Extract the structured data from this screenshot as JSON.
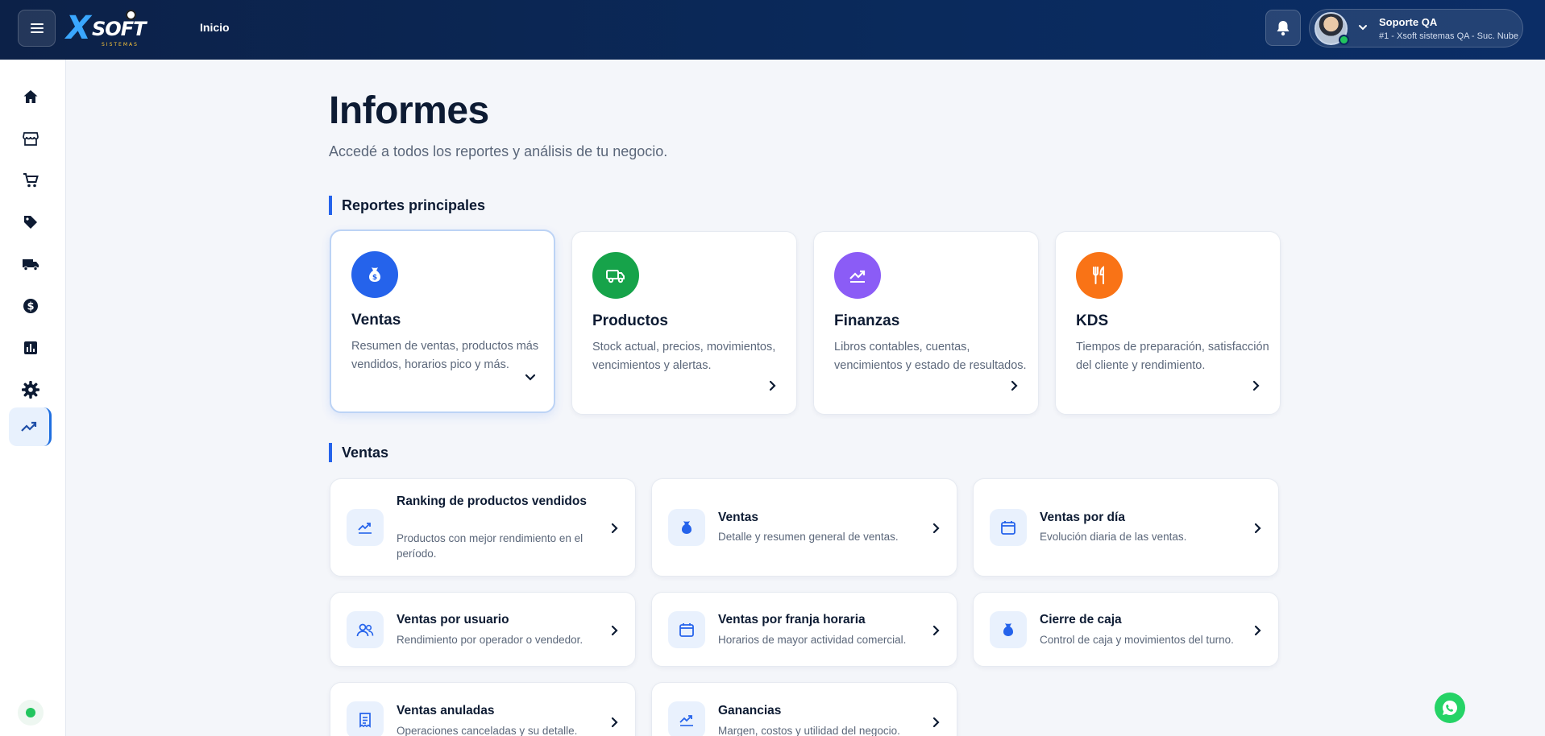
{
  "header": {
    "breadcrumb": "Inicio",
    "logo_text": "SOFT",
    "logo_x": "X",
    "logo_sub": "SISTEMAS",
    "user_name": "Soporte QA",
    "user_branch": "#1 - Xsoft sistemas QA - Suc. Nube"
  },
  "sidebar": {
    "items": [
      {
        "icon": "home-icon"
      },
      {
        "icon": "store-icon"
      },
      {
        "icon": "cart-icon"
      },
      {
        "icon": "tag-icon"
      },
      {
        "icon": "truck-icon"
      },
      {
        "icon": "dollar-icon"
      },
      {
        "icon": "bar-chart-icon"
      },
      {
        "icon": "gear-icon"
      },
      {
        "icon": "trending-up-icon",
        "active": true
      }
    ]
  },
  "main": {
    "title": "Informes",
    "subtitle": "Accedé a todos los reportes y análisis de tu negocio.",
    "section_main": "Reportes principales",
    "section_sales": "Ventas",
    "main_cards": [
      {
        "title": "Ventas",
        "desc": "Resumen de ventas, productos más vendidos, horarios pico y más.",
        "color": "#2563eb"
      },
      {
        "title": "Productos",
        "desc": "Stock actual, precios, movimientos, vencimientos y alertas.",
        "color": "#16a34a"
      },
      {
        "title": "Finanzas",
        "desc": "Libros contables, cuentas, vencimientos y estado de resultados.",
        "color": "#8b5cf6"
      },
      {
        "title": "KDS",
        "desc": "Tiempos de preparación, satisfacción del cliente y rendimiento.",
        "color": "#f97316"
      }
    ],
    "sub_cards": [
      {
        "title": "Ranking de productos vendidos",
        "desc": "Productos con mejor rendimiento en el período."
      },
      {
        "title": "Ventas",
        "desc": "Detalle y resumen general de ventas."
      },
      {
        "title": "Ventas por día",
        "desc": "Evolución diaria de las ventas."
      },
      {
        "title": "Ventas por usuario",
        "desc": "Rendimiento por operador o vendedor."
      },
      {
        "title": "Ventas por franja horaria",
        "desc": "Horarios de mayor actividad comercial."
      },
      {
        "title": "Cierre de caja",
        "desc": "Control de caja y movimientos del turno."
      },
      {
        "title": "Ventas anuladas",
        "desc": "Operaciones canceladas y su detalle."
      },
      {
        "title": "Ganancias",
        "desc": "Margen, costos y utilidad del negocio."
      }
    ]
  },
  "colors": {
    "accent": "#2563eb",
    "header": "#0b2a5e",
    "online": "#22c55e"
  }
}
